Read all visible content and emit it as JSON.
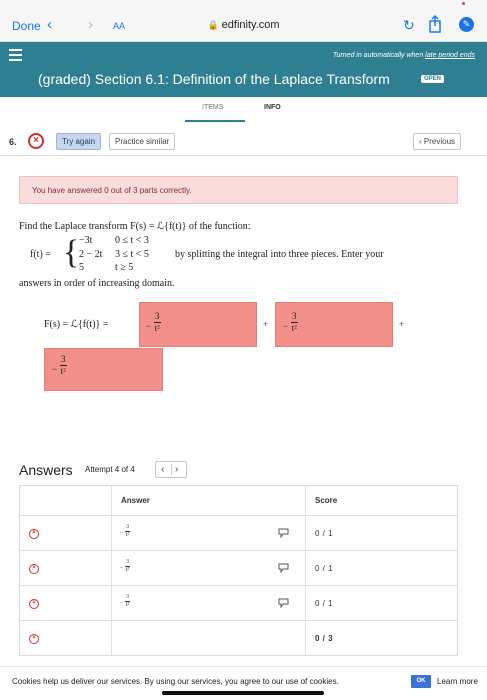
{
  "browser": {
    "done_label": "Done",
    "text_size_label": "AA",
    "url": "edfinity.com"
  },
  "header": {
    "notice_prefix": "Turned in automatically when ",
    "notice_link": "late period ends",
    "title": "(graded) Section 6.1: Definition of the Laplace Transform",
    "badge": "OPEN"
  },
  "tabs": [
    {
      "label": "ITEMS"
    },
    {
      "label": "INFO"
    }
  ],
  "question": {
    "number": "6.",
    "try_again_label": "Try again",
    "practice_label": "Practice similar",
    "previous_label": "Previous"
  },
  "alert": {
    "text": "You have answered 0 out of 3 parts correctly."
  },
  "problem": {
    "line1": "Find the Laplace transform F(s) = ℒ{f(t)} of the function:",
    "f_label": "f(t) =",
    "pieces": [
      {
        "expr": "−3t",
        "domain": "0 ≤ t < 3"
      },
      {
        "expr": "2 − 2t",
        "domain": "3 ≤ t < 5"
      },
      {
        "expr": "5",
        "domain": "t ≥ 5"
      }
    ],
    "mid_text": "by splitting the integral into three pieces. Enter your",
    "line3": "answers in order of increasing domain."
  },
  "answer_entry": {
    "label": "F(s) = ℒ{f(t)} =",
    "plus": "+",
    "boxes": [
      {
        "sign": "−",
        "numerator": "3",
        "denominator": "t²"
      },
      {
        "sign": "−",
        "numerator": "3",
        "denominator": "t²"
      },
      {
        "sign": "−",
        "numerator": "3",
        "denominator": "t²"
      }
    ]
  },
  "answers": {
    "title": "Answers",
    "attempt_text": "Attempt 4 of 4",
    "headers": {
      "answer": "Answer",
      "score": "Score"
    },
    "rows": [
      {
        "sign": "−",
        "numerator": "3",
        "denominator": "t²",
        "score": "0 / 1"
      },
      {
        "sign": "−",
        "numerator": "3",
        "denominator": "t²",
        "score": "0 / 1"
      },
      {
        "sign": "−",
        "numerator": "3",
        "denominator": "t²",
        "score": "0 / 1"
      }
    ],
    "total_score": "0 / 3"
  },
  "cookie": {
    "message": "Cookies help us deliver our services. By using our services, you agree to our use of cookies.",
    "ok_label": "OK",
    "learn_more_label": "Learn more"
  },
  "colors": {
    "header_teal": "#2f7f92",
    "error_red": "#d32f2f",
    "incorrect_box": "#f28f88",
    "alert_bg": "#f9dcdc",
    "link_blue": "#1a73e8"
  }
}
